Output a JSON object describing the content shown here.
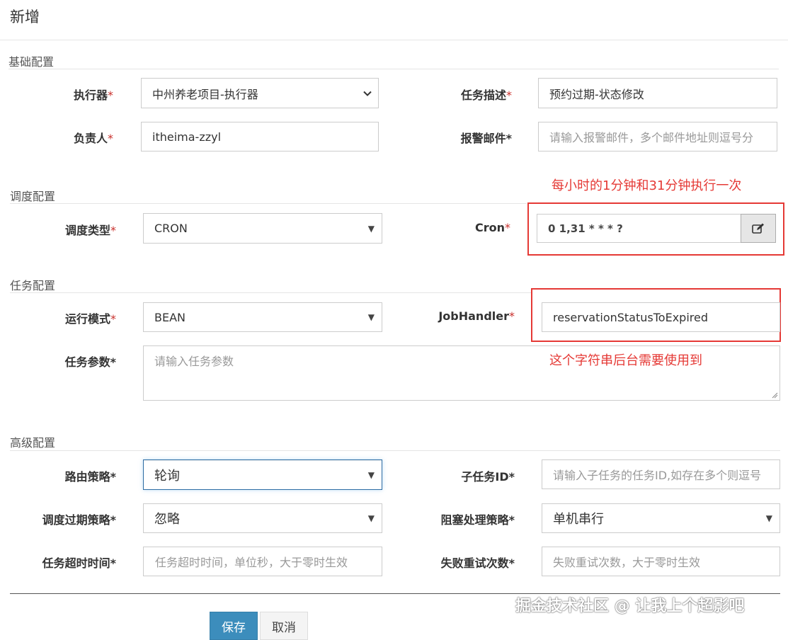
{
  "modal": {
    "title": "新增"
  },
  "sections": {
    "basic": "基础配置",
    "schedule": "调度配置",
    "task": "任务配置",
    "advanced": "高级配置"
  },
  "required_mark": "*",
  "fields": {
    "executor": {
      "label": "执行器",
      "value": "中州养老项目-执行器"
    },
    "job_desc": {
      "label": "任务描述",
      "value": "预约过期-状态修改"
    },
    "author": {
      "label": "负责人",
      "value": "itheima-zzyl"
    },
    "alarm_email": {
      "label": "报警邮件",
      "placeholder": "请输入报警邮件，多个邮件地址则逗号分"
    },
    "schedule_type": {
      "label": "调度类型",
      "value": "CRON"
    },
    "cron": {
      "label": "Cron",
      "value": "0 1,31 * * * ?"
    },
    "glue_type": {
      "label": "运行模式",
      "value": "BEAN"
    },
    "job_handler": {
      "label": "JobHandler",
      "value": "reservationStatusToExpired"
    },
    "job_param": {
      "label": "任务参数",
      "placeholder": "请输入任务参数"
    },
    "route_strategy": {
      "label": "路由策略",
      "value": "轮询"
    },
    "child_job_id": {
      "label": "子任务ID",
      "placeholder": "请输入子任务的任务ID,如存在多个则逗号"
    },
    "misfire_strategy": {
      "label": "调度过期策略",
      "value": "忽略"
    },
    "block_strategy": {
      "label": "阻塞处理策略",
      "value": "单机串行"
    },
    "timeout": {
      "label": "任务超时时间",
      "placeholder": "任务超时时间，单位秒，大于零时生效"
    },
    "fail_retry": {
      "label": "失败重试次数",
      "placeholder": "失败重试次数，大于零时生效"
    }
  },
  "annotations": {
    "cron_note": "每小时的1分钟和31分钟执行一次",
    "handler_note": "这个字符串后台需要使用到"
  },
  "buttons": {
    "save": "保存",
    "cancel": "取消"
  },
  "watermark": "掘金技术社区 @ 让我上个超影吧",
  "colors": {
    "annotation": "#e53935",
    "primary": "#3c8dbc",
    "required": "#c9302c"
  },
  "icons": {
    "cron_edit": "edit-icon",
    "select_arrow": "caret-down-icon"
  }
}
